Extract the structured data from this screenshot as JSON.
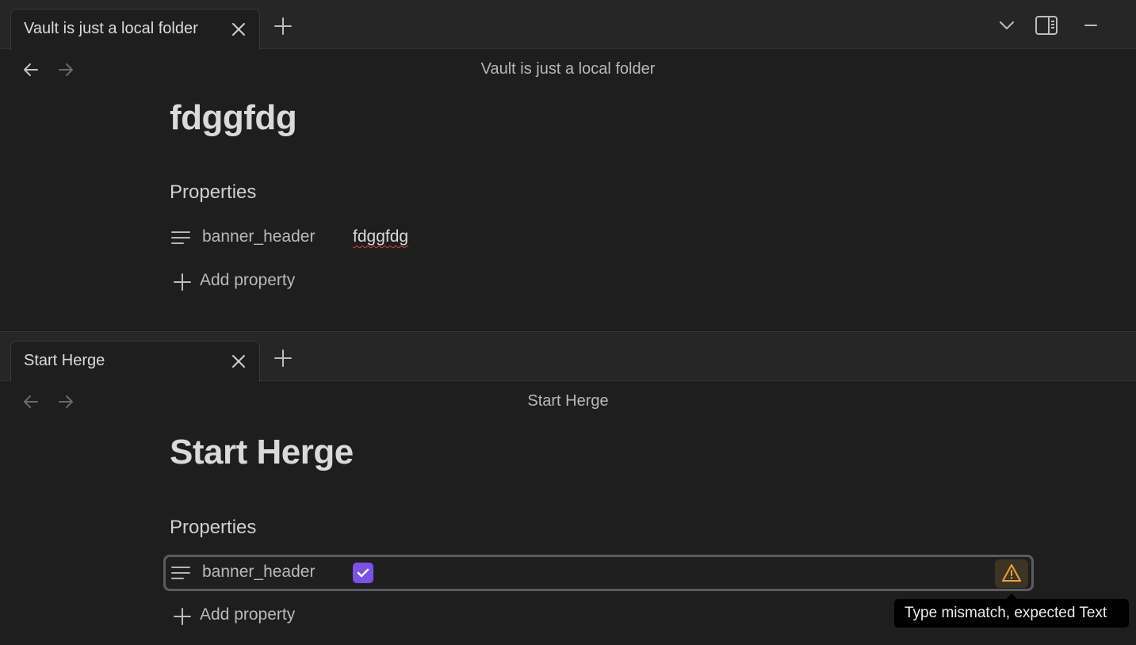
{
  "top_pane": {
    "tab": {
      "label": "Vault is just a local folder",
      "close_icon": "close-icon"
    },
    "new_tab_icon": "plus-icon",
    "window_controls": [
      "chevron-down-icon",
      "sidebar-toggle-icon",
      "minimize-icon"
    ],
    "nav": {
      "back_icon": "arrow-left-icon",
      "forward_icon": "arrow-right-icon",
      "title": "Vault is just a local folder"
    },
    "note_title": "fdggfdg",
    "properties_heading": "Properties",
    "properties": [
      {
        "icon": "text-lines-icon",
        "key": "banner_header",
        "value": "fdggfdg"
      }
    ],
    "add_property_label": "Add property"
  },
  "bottom_pane": {
    "tab": {
      "label": "Start Herge",
      "close_icon": "close-icon"
    },
    "new_tab_icon": "plus-icon",
    "nav": {
      "back_icon": "arrow-left-icon",
      "forward_icon": "arrow-right-icon",
      "title": "Start Herge"
    },
    "note_title": "Start Herge",
    "properties_heading": "Properties",
    "properties": [
      {
        "icon": "text-lines-icon",
        "key": "banner_header",
        "value_type": "checkbox",
        "checked": true,
        "warning_icon": "warning-triangle-icon"
      }
    ],
    "add_property_label": "Add property"
  },
  "tooltip": {
    "text": "Type mismatch, expected Text"
  },
  "colors": {
    "background": "#1e1e1e",
    "accent": "#7b52e6",
    "warning": "#e8a33d",
    "spellcheck": "#e0443e"
  }
}
